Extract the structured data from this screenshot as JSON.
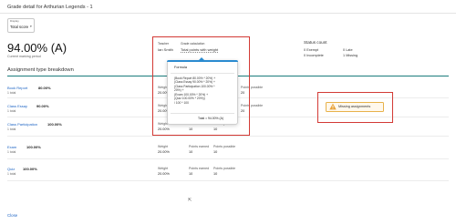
{
  "page": {
    "title": "Grade detail for Arthurian Legends - 1"
  },
  "display": {
    "caption": "Display",
    "value": "Total score",
    "chevron_icon": "chevron-down-icon"
  },
  "score": {
    "value": "94.00% (A)",
    "subtitle": "Current marking period"
  },
  "teacher": {
    "label": "Teacher",
    "value": "Ian Smith"
  },
  "grade_calculation": {
    "label": "Grade calculation",
    "value": "Total points with weight"
  },
  "status_count": {
    "title": "Status count",
    "items": [
      {
        "count": "0",
        "label": "Exempt"
      },
      {
        "count": "0",
        "label": "Late"
      },
      {
        "count": "0",
        "label": "Incomplete"
      },
      {
        "count": "1",
        "label": "Missing"
      }
    ]
  },
  "breakdown": {
    "title": "Assignment type breakdown",
    "weight_label": "Weight",
    "points_label": "Points earned",
    "possible_label": "Points possible",
    "rows": [
      {
        "name": "Book Report",
        "percent": "80.00%",
        "sub": "1 total",
        "weight": "20.00%",
        "earned": "16",
        "possible": "20"
      },
      {
        "name": "Class Essay",
        "percent": "90.00%",
        "sub": "1 total",
        "weight": "20.00%",
        "earned": "18",
        "possible": "20"
      },
      {
        "name": "Class Participation",
        "percent": "100.00%",
        "sub": "1 total",
        "weight": "20.00%",
        "earned": "10",
        "possible": "10"
      },
      {
        "name": "Exam",
        "percent": "100.00%",
        "sub": "1 total",
        "weight": "20.00%",
        "earned": "10",
        "possible": "10"
      },
      {
        "name": "Quiz",
        "percent": "100.00%",
        "sub": "1 total",
        "weight": "20.00%",
        "earned": "10",
        "possible": "10"
      }
    ]
  },
  "formula_popup": {
    "heading": "Formula",
    "lines": [
      "(Book Report 80.00% * 20%) +",
      "(Class Essay 90.00% * 20%) +",
      "(Class Participation 100.00% *",
      "20%) +",
      "(Exam 100.00% * 20%) +",
      "(Quiz 100.00% * 20%))",
      "/ 100 * 100"
    ],
    "total": "Total = 94.00% (A)"
  },
  "warning": {
    "text": "Missing assignments",
    "icon": "warning-triangle-icon",
    "color": "#e8a33a"
  },
  "footer": {
    "close_label": "Close"
  },
  "colors": {
    "accent": "#1a7c7c",
    "link": "#1d64c4",
    "highlight": "#d33a35",
    "popup_bar": "#2a8bd0"
  }
}
